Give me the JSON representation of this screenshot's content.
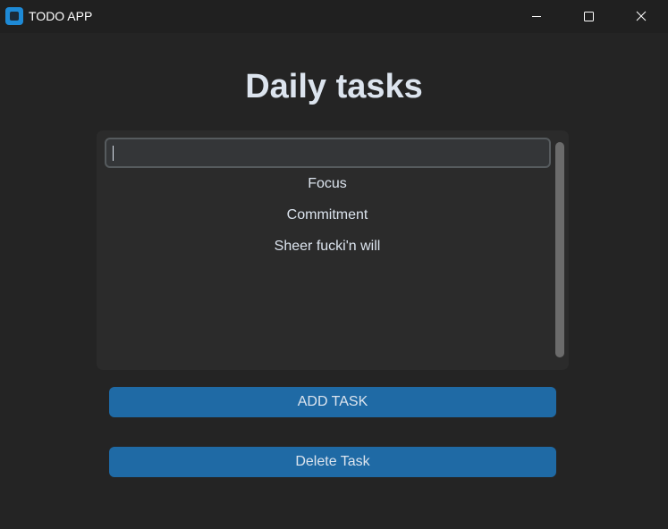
{
  "window": {
    "title": "TODO APP",
    "app_icon": "app-icon",
    "controls": [
      "minimize-icon",
      "maximize-icon",
      "close-icon"
    ]
  },
  "page": {
    "title": "Daily tasks"
  },
  "task_input": {
    "value": "",
    "placeholder": ""
  },
  "tasks": [
    {
      "label": "Focus"
    },
    {
      "label": "Commitment"
    },
    {
      "label": "Sheer fucki'n will"
    }
  ],
  "buttons": {
    "add_label": "ADD TASK",
    "delete_label": "Delete Task"
  },
  "colors": {
    "background": "#242424",
    "titlebar": "#202020",
    "frame": "#2b2b2b",
    "input_bg": "#343638",
    "input_border": "#565b5e",
    "accent": "#1f6aa5",
    "text": "#dce4ee",
    "scrollbar": "#6b6b6b"
  }
}
